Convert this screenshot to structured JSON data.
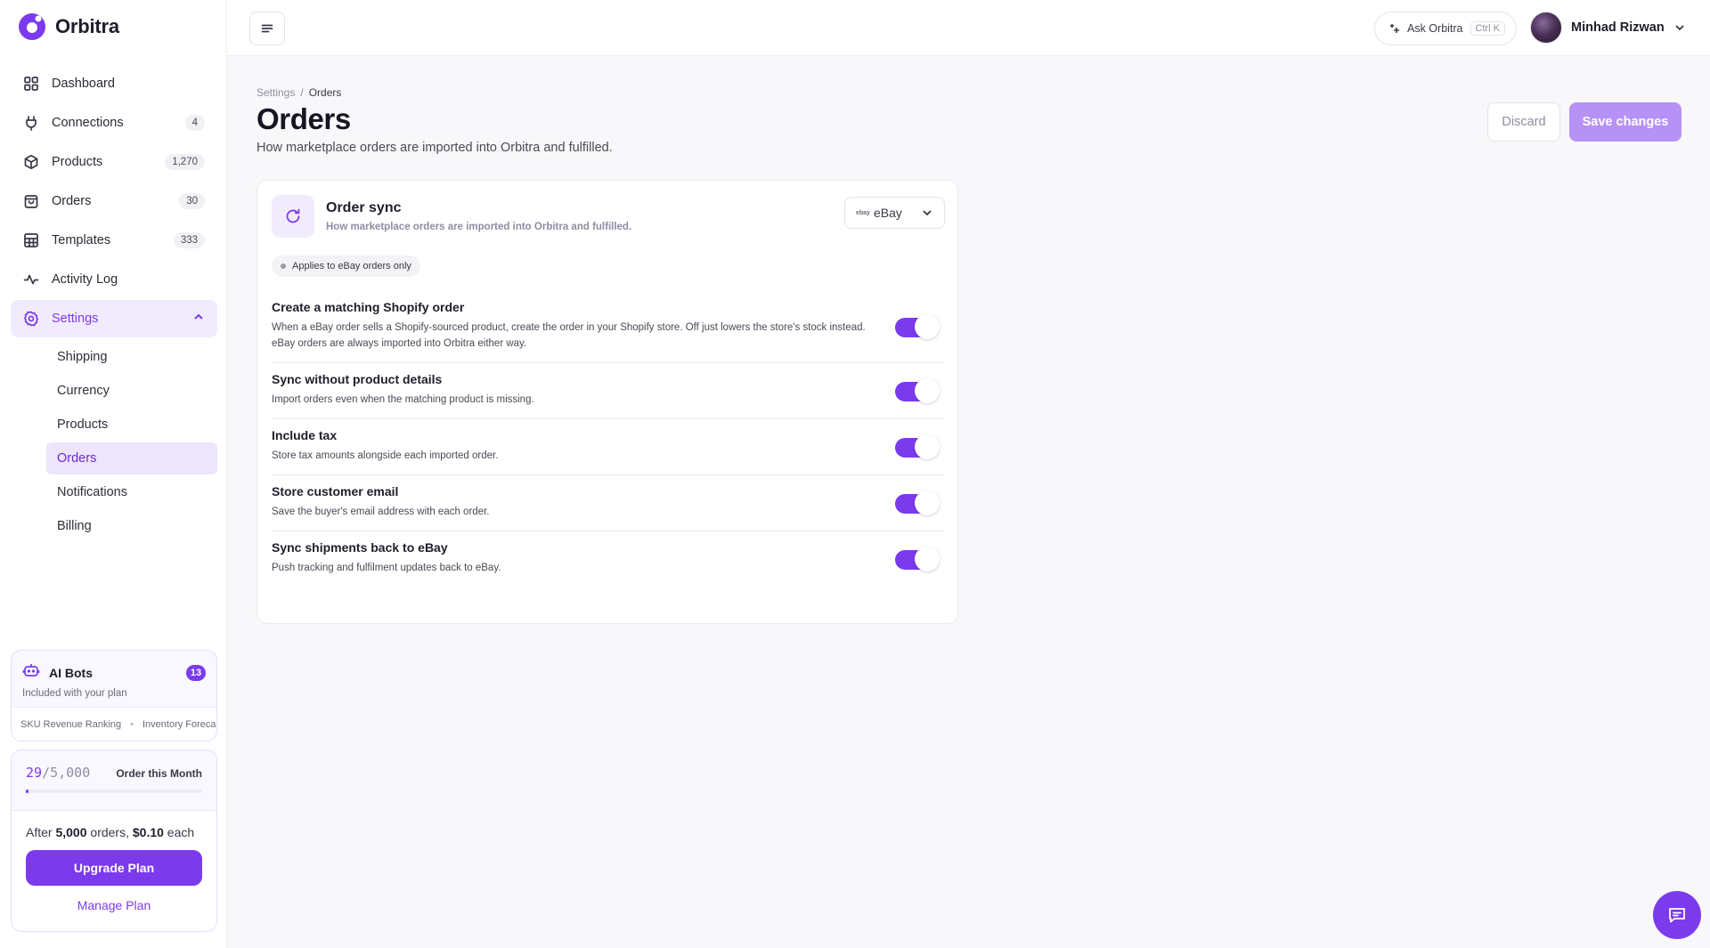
{
  "brand": {
    "name": "Orbitra"
  },
  "nav": {
    "items": [
      {
        "label": "Dashboard",
        "icon": "grid-icon",
        "count": null
      },
      {
        "label": "Connections",
        "icon": "plug-icon",
        "count": "4"
      },
      {
        "label": "Products",
        "icon": "box-icon",
        "count": "1,270"
      },
      {
        "label": "Orders",
        "icon": "shopping-bag-icon",
        "count": "30"
      },
      {
        "label": "Templates",
        "icon": "table-icon",
        "count": "333"
      },
      {
        "label": "Activity Log",
        "icon": "activity-icon",
        "count": null
      },
      {
        "label": "Settings",
        "icon": "gear-icon",
        "count": null
      }
    ],
    "settings_sub": [
      "Shipping",
      "Currency",
      "Products",
      "Orders",
      "Notifications",
      "Billing"
    ],
    "active_sub": "Orders"
  },
  "bots": {
    "title": "AI Bots",
    "count": "13",
    "subtitle": "Included with your plan",
    "strip": [
      "SKU Revenue Ranking",
      "Inventory Forecast"
    ]
  },
  "plan": {
    "used": "29",
    "limit": "/5,000",
    "label": "Order this Month",
    "fill_fraction": 0.0058,
    "note_prefix": "After ",
    "note_orders": "5,000",
    "note_mid": " orders, ",
    "note_price": "$0.10",
    "note_suffix": " each",
    "upgrade_label": "Upgrade Plan",
    "manage_label": "Manage Plan"
  },
  "topbar": {
    "ask_label": "Ask Orbitra",
    "ask_shortcut": "Ctrl K",
    "user_name": "Minhad Rizwan"
  },
  "page": {
    "breadcrumb_parent": "Settings",
    "breadcrumb_sep": "/",
    "breadcrumb_current": "Orders",
    "title": "Orders",
    "subtitle": "How marketplace orders are imported into Orbitra and fulfilled.",
    "discard_label": "Discard",
    "save_label": "Save changes"
  },
  "card": {
    "title": "Order sync",
    "description": "How marketplace orders are imported into Orbitra and fulfilled.",
    "marketplace_logo": "ebay",
    "marketplace_name": "eBay",
    "applies_label": "Applies to eBay orders only",
    "settings": [
      {
        "title": "Create a matching Shopify order",
        "description": "When a eBay order sells a Shopify-sourced product, create the order in your Shopify store. Off just lowers the store's stock instead. eBay orders are always imported into Orbitra either way.",
        "enabled": true
      },
      {
        "title": "Sync without product details",
        "description": "Import orders even when the matching product is missing.",
        "enabled": true
      },
      {
        "title": "Include tax",
        "description": "Store tax amounts alongside each imported order.",
        "enabled": true
      },
      {
        "title": "Store customer email",
        "description": "Save the buyer's email address with each order.",
        "enabled": true
      },
      {
        "title": "Sync shipments back to eBay",
        "description": "Push tracking and fulfilment updates back to eBay.",
        "enabled": true
      }
    ]
  },
  "colors": {
    "accent": "#7c3aed",
    "accent_soft": "#f1ecfd",
    "save_disabled": "#b691f6"
  }
}
